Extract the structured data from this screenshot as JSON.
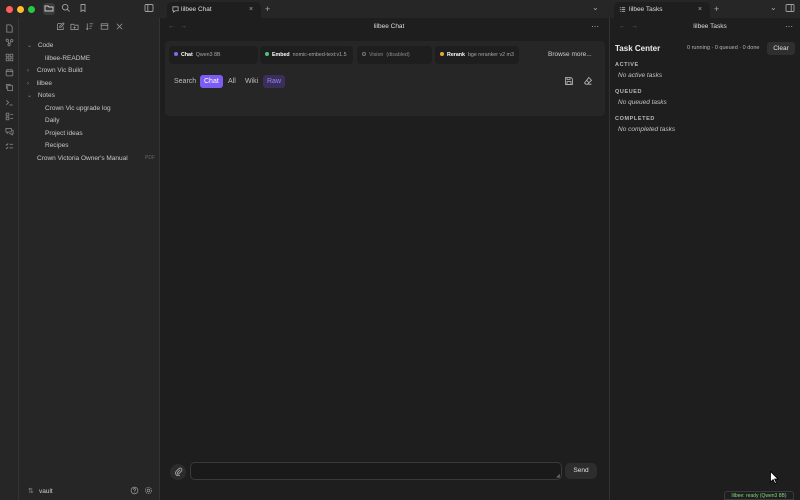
{
  "titlebar": {
    "traffic_colors": [
      "#ff5f57",
      "#febc2e",
      "#28c840"
    ]
  },
  "tabs": {
    "chat_tab_label": "lilbee Chat",
    "tasks_tab_label": "lilbee Tasks",
    "new_tab_icon": "+",
    "close_icon": "×",
    "dropdown_icon": "⌄"
  },
  "sidebar": {
    "tree": [
      {
        "label": "Code",
        "type": "folder",
        "expanded": true
      },
      {
        "label": "lilbee-README",
        "type": "file"
      },
      {
        "label": "Crown Vic Build",
        "type": "folder",
        "expanded": false
      },
      {
        "label": "lilbee",
        "type": "folder",
        "expanded": false
      },
      {
        "label": "Notes",
        "type": "folder",
        "expanded": true
      },
      {
        "label": "Crown Vic upgrade log",
        "type": "file"
      },
      {
        "label": "Daily",
        "type": "file"
      },
      {
        "label": "Project ideas",
        "type": "file"
      },
      {
        "label": "Recipes",
        "type": "file"
      },
      {
        "label": "Crown Victoria Owner's Manual",
        "type": "file",
        "badge": "PDF"
      }
    ],
    "vault_label": "vault"
  },
  "chat": {
    "title": "lilbee Chat",
    "models": {
      "chat": {
        "key": "Chat",
        "value": "Qwen3 8B",
        "color": "#7c6cf2"
      },
      "embed": {
        "key": "Embed",
        "value": "nomic-embed-text:v1.5",
        "color": "#4ec27a"
      },
      "vision": {
        "key": "Vision",
        "value": "(disabled)",
        "color": "#777777"
      },
      "rerank": {
        "key": "Rerank",
        "value": "bge reranker v2 m3",
        "color": "#e5a93b"
      }
    },
    "browse_label": "Browse more...",
    "modes": {
      "search": "Search",
      "chat": "Chat",
      "all": "All",
      "wiki": "Wiki",
      "raw": "Raw"
    },
    "input_placeholder": "",
    "send_label": "Send"
  },
  "tasks": {
    "title": "lilbee Tasks",
    "center_title": "Task Center",
    "summary": "0 running · 0 queued · 0 done",
    "clear_label": "Clear",
    "active_label": "ACTIVE",
    "active_empty": "No active tasks",
    "queued_label": "QUEUED",
    "queued_empty": "No queued tasks",
    "completed_label": "COMPLETED",
    "completed_empty": "No completed tasks"
  },
  "status": {
    "text": "lilbee: ready (Qwen3 8B)",
    "color": "#7fdc7f"
  },
  "colors": {
    "accent": "#7c5cf2",
    "background": "#1e1e1e",
    "panel": "#262626"
  }
}
